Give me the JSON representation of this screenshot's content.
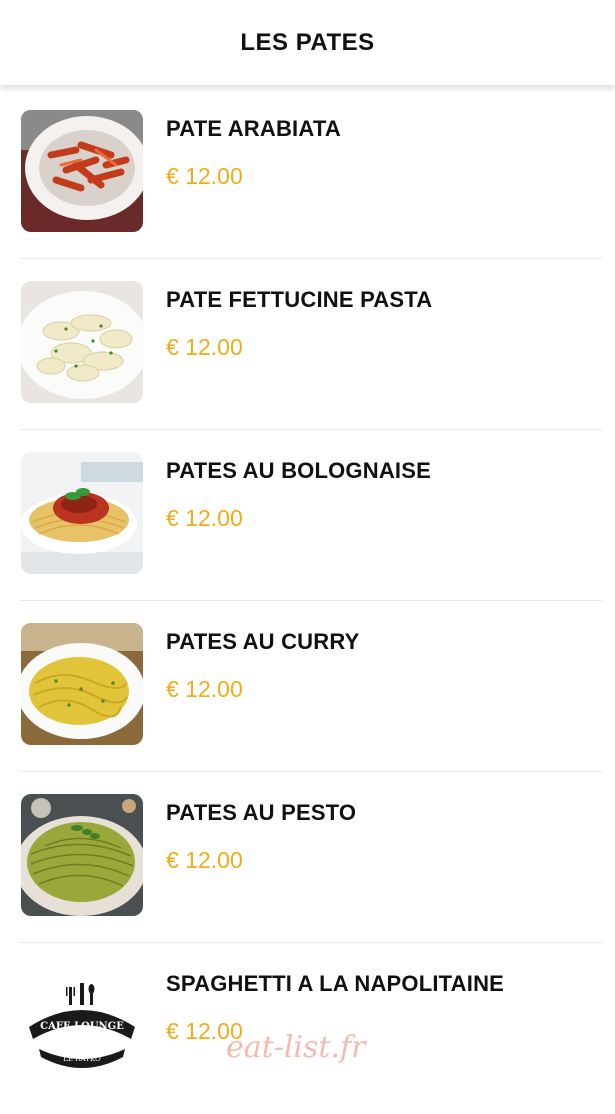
{
  "header": {
    "title": "LES PATES"
  },
  "items": [
    {
      "name": "PATE ARABIATA",
      "price": "€ 12.00",
      "image": "penne-arrabbiata-photo"
    },
    {
      "name": "PATE FETTUCINE PASTA",
      "price": "€ 12.00",
      "image": "fettuccine-alfredo-photo"
    },
    {
      "name": "PATES AU BOLOGNAISE",
      "price": "€ 12.00",
      "image": "spaghetti-bolognese-photo"
    },
    {
      "name": "PATES AU CURRY",
      "price": "€ 12.00",
      "image": "curry-pasta-photo"
    },
    {
      "name": "PATES AU PESTO",
      "price": "€ 12.00",
      "image": "pesto-pasta-photo"
    },
    {
      "name": "SPAGHETTI A LA NAPOLITAINE",
      "price": "€ 12.00",
      "image": "cafe-lounge-logo"
    }
  ],
  "logo": {
    "line1": "CAFE LOUNGE",
    "line2": "LE RAYKO"
  },
  "watermark": "eat-list.fr",
  "colors": {
    "price": "#f0ad1b",
    "text": "#111111",
    "divider": "#e8e8e8"
  }
}
